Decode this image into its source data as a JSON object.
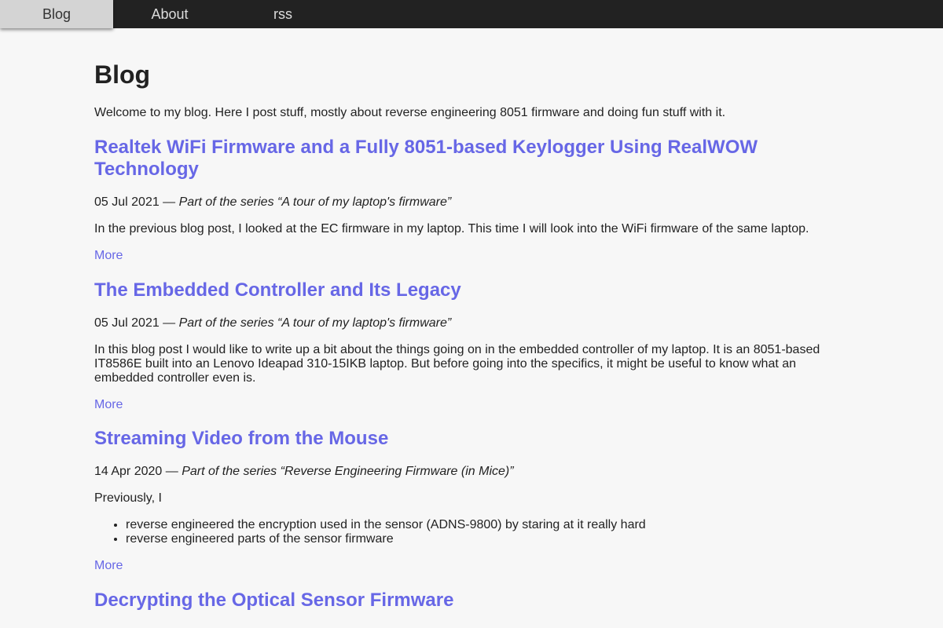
{
  "nav": {
    "items": [
      {
        "label": "Blog"
      },
      {
        "label": "About"
      },
      {
        "label": "rss"
      }
    ]
  },
  "page": {
    "title": "Blog",
    "intro": "Welcome to my blog. Here I post stuff, mostly about reverse engineering 8051 firmware and doing fun stuff with it."
  },
  "posts": [
    {
      "title": "Realtek WiFi Firmware and a Fully 8051-based Keylogger Using RealWOW Technology",
      "date": "05 Jul 2021",
      "separator": " — ",
      "series": "Part of the series “A tour of my laptop's firmware”",
      "excerpt": "In the previous blog post, I looked at the EC firmware in my laptop. This time I will look into the WiFi firmware of the same laptop.",
      "more": "More"
    },
    {
      "title": "The Embedded Controller and Its Legacy",
      "date": "05 Jul 2021",
      "separator": " — ",
      "series": "Part of the series “A tour of my laptop's firmware”",
      "excerpt": "In this blog post I would like to write up a bit about the things going on in the embedded controller of my laptop. It is an 8051-based IT8586E built into an Lenovo Ideapad 310-15IKB laptop. But before going into the specifics, it might be useful to know what an embedded controller even is.",
      "more": "More"
    },
    {
      "title": "Streaming Video from the Mouse",
      "date": "14 Apr 2020",
      "separator": " — ",
      "series": "Part of the series “Reverse Engineering Firmware (in Mice)”",
      "excerpt": "Previously, I",
      "bullets": [
        "reverse engineered the encryption used in the sensor (ADNS-9800) by staring at it really hard",
        "reverse engineered parts of the sensor firmware"
      ],
      "more": "More"
    },
    {
      "title": "Decrypting the Optical Sensor Firmware"
    }
  ],
  "colors": {
    "link": "#6767e6",
    "navbar": "#222222",
    "nav_active": "#d4d4d4",
    "background": "#f7f7f7",
    "text": "#222222"
  }
}
